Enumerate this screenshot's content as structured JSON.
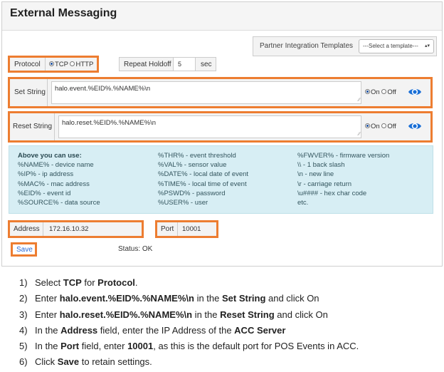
{
  "panel": {
    "title": "External Messaging"
  },
  "templates": {
    "label": "Partner Integration Templates",
    "select_value": "---Select a template---"
  },
  "protocol": {
    "label": "Protocol",
    "options": [
      {
        "label": "TCP",
        "selected": true
      },
      {
        "label": "HTTP",
        "selected": false
      }
    ]
  },
  "holdoff": {
    "label": "Repeat Holdoff",
    "value": "5",
    "unit": "sec"
  },
  "set_string": {
    "label": "Set String",
    "value": "halo.event.%EID%.%NAME%\\n",
    "on_label": "On",
    "off_label": "Off",
    "state": "On"
  },
  "reset_string": {
    "label": "Reset String",
    "value": "halo.reset.%EID%.%NAME%\\n",
    "on_label": "On",
    "off_label": "Off",
    "state": "On"
  },
  "info": {
    "col1": [
      "Above you can use:",
      "%NAME% - device name",
      "%IP% - ip address",
      "%MAC% - mac address",
      "%EID% - event id",
      "%SOURCE% - data source"
    ],
    "col2": [
      "%THR% - event threshold",
      "%VAL% - sensor value",
      "%DATE% - local date of event",
      "%TIME% - local time of event",
      "%PSWD% - password",
      "%USER% - user"
    ],
    "col3": [
      "%FWVER% - firmware version",
      "\\\\ - 1 back slash",
      "\\n - new line",
      "\\r - carriage return",
      "\\u#### - hex char code",
      "etc."
    ]
  },
  "address": {
    "label": "Address",
    "value": "172.16.10.32"
  },
  "port": {
    "label": "Port",
    "value": "10001"
  },
  "save_label": "Save",
  "status": "Status: OK",
  "colors": {
    "highlight": "#ed7d31",
    "info_bg": "#d7eef4",
    "accent": "#1a6fd6"
  },
  "steps": [
    {
      "num": "1)",
      "parts": [
        "Select ",
        "TCP",
        " for ",
        "Protocol",
        "."
      ]
    },
    {
      "num": "2)",
      "parts": [
        "Enter ",
        "halo.event.%EID%.%NAME%\\n",
        " in the ",
        "Set String",
        " and click On"
      ]
    },
    {
      "num": "3)",
      "parts": [
        "Enter ",
        "halo.reset.%EID%.%NAME%\\n",
        " in the ",
        "Reset String",
        " and click On"
      ]
    },
    {
      "num": "4)",
      "parts": [
        "In the ",
        "Address",
        " field, enter the IP Address of the ",
        "ACC Server"
      ]
    },
    {
      "num": "5)",
      "parts": [
        "In the ",
        "Port",
        " field, enter ",
        "10001",
        ", as this is the default port for POS Events in ACC."
      ]
    },
    {
      "num": "6)",
      "parts": [
        "Click ",
        "Save",
        " to retain settings."
      ]
    }
  ]
}
